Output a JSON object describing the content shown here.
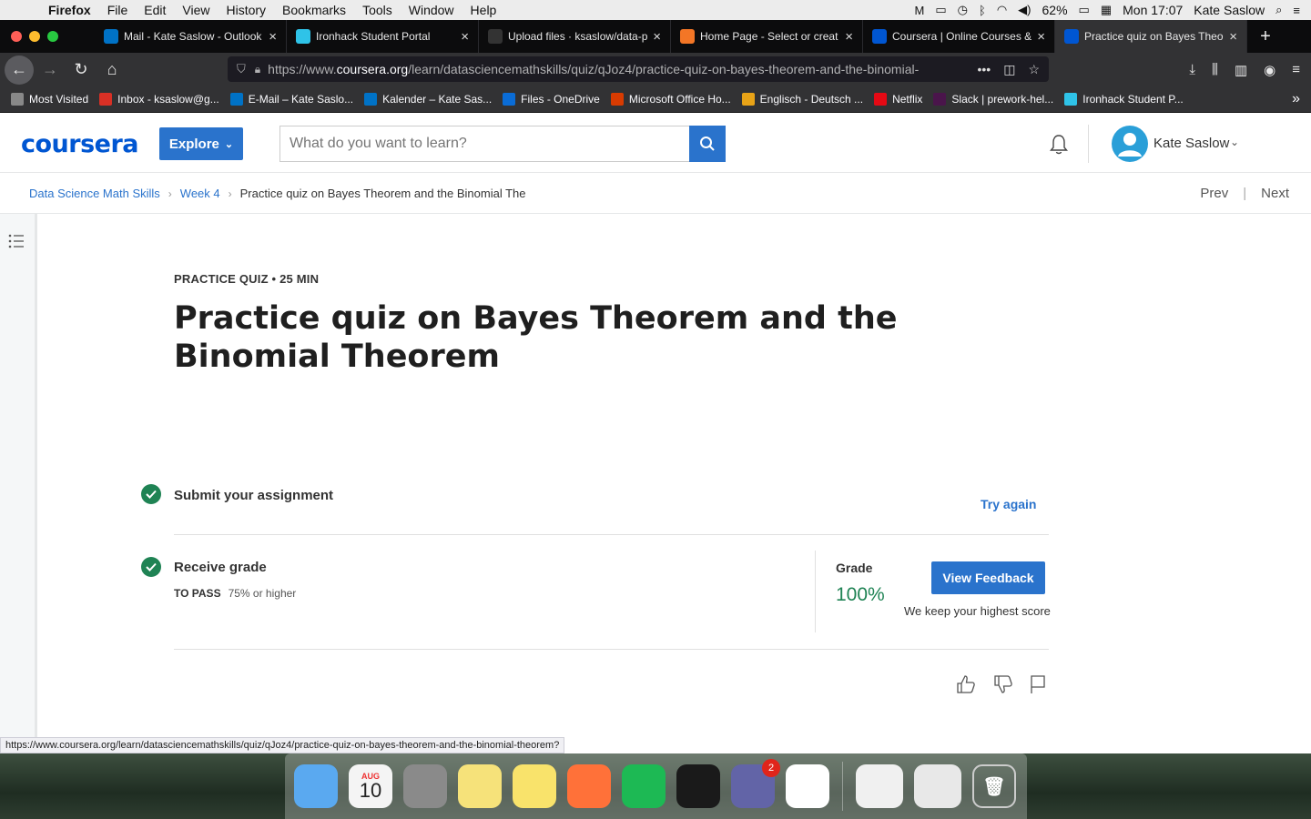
{
  "menubar": {
    "app": "Firefox",
    "items": [
      "File",
      "Edit",
      "View",
      "History",
      "Bookmarks",
      "Tools",
      "Window",
      "Help"
    ],
    "battery": "62%",
    "clock": "Mon 17:07",
    "user": "Kate Saslow"
  },
  "tabs": [
    {
      "title": "Mail - Kate Saslow - Outlook",
      "icon": "outlook-icon",
      "color": "#0072c6",
      "active": false
    },
    {
      "title": "Ironhack Student Portal",
      "icon": "ironhack-icon",
      "color": "#2fc3e8",
      "active": false
    },
    {
      "title": "Upload files · ksaslow/data-p",
      "icon": "github-icon",
      "color": "#333333",
      "active": false
    },
    {
      "title": "Home Page - Select or creat",
      "icon": "jupyter-icon",
      "color": "#f37626",
      "active": false
    },
    {
      "title": "Coursera | Online Courses &",
      "icon": "coursera-icon",
      "color": "#0056d2",
      "active": false
    },
    {
      "title": "Practice quiz on Bayes Theor",
      "icon": "coursera-icon",
      "color": "#0056d2",
      "active": true
    }
  ],
  "url": {
    "prefix": "https://www.",
    "domain": "coursera.org",
    "path": "/learn/datasciencemathskills/quiz/qJoz4/practice-quiz-on-bayes-theorem-and-the-binomial-"
  },
  "bookmarks": [
    {
      "label": "Most Visited",
      "color": "#888888"
    },
    {
      "label": "Inbox - ksaslow@g...",
      "color": "#d93025"
    },
    {
      "label": "E-Mail – Kate Saslo...",
      "color": "#0072c6"
    },
    {
      "label": "Kalender – Kate Sas...",
      "color": "#0072c6"
    },
    {
      "label": "Files - OneDrive",
      "color": "#0a6cd6"
    },
    {
      "label": "Microsoft Office Ho...",
      "color": "#d83b01"
    },
    {
      "label": "Englisch - Deutsch ...",
      "color": "#e8a317"
    },
    {
      "label": "Netflix",
      "color": "#e50914"
    },
    {
      "label": "Slack | prework-hel...",
      "color": "#4a154b"
    },
    {
      "label": "Ironhack Student P...",
      "color": "#2fc3e8"
    }
  ],
  "header": {
    "logo": "coursera",
    "explore": "Explore",
    "search_placeholder": "What do you want to learn?",
    "user_name": "Kate Saslow"
  },
  "breadcrumb": {
    "course": "Data Science Math Skills",
    "week": "Week 4",
    "current": "Practice quiz on Bayes Theorem and the Binomial The",
    "prev": "Prev",
    "next": "Next"
  },
  "quiz": {
    "kicker": "PRACTICE QUIZ • 25 MIN",
    "title": "Practice quiz on Bayes Theorem and the Binomial Theorem",
    "submit_label": "Submit your assignment",
    "try_again": "Try again",
    "receive_label": "Receive grade",
    "to_pass_label": "TO PASS",
    "to_pass_value": "75% or higher",
    "grade_label": "Grade",
    "grade_value": "100%",
    "view_feedback": "View Feedback",
    "highest_note": "We keep your highest score"
  },
  "status_url": "https://www.coursera.org/learn/datasciencemathskills/quiz/qJoz4/practice-quiz-on-bayes-theorem-and-the-binomial-theorem?",
  "dock": {
    "apps": [
      {
        "name": "finder-icon",
        "color": "#5aa9f0"
      },
      {
        "name": "calendar-icon",
        "color": "#f4f4f4"
      },
      {
        "name": "system-preferences-icon",
        "color": "#8a8a8a"
      },
      {
        "name": "stickies-icon",
        "color": "#f6e27a"
      },
      {
        "name": "notes-icon",
        "color": "#f9e36b"
      },
      {
        "name": "firefox-icon",
        "color": "#ff7139"
      },
      {
        "name": "spotify-icon",
        "color": "#1db954"
      },
      {
        "name": "terminal-icon",
        "color": "#1a1a1a"
      },
      {
        "name": "teams-icon",
        "color": "#6264a7"
      },
      {
        "name": "slack-icon",
        "color": "#ffffff"
      }
    ],
    "calendar_month": "AUG",
    "calendar_day": "10",
    "teams_badge": "2"
  }
}
